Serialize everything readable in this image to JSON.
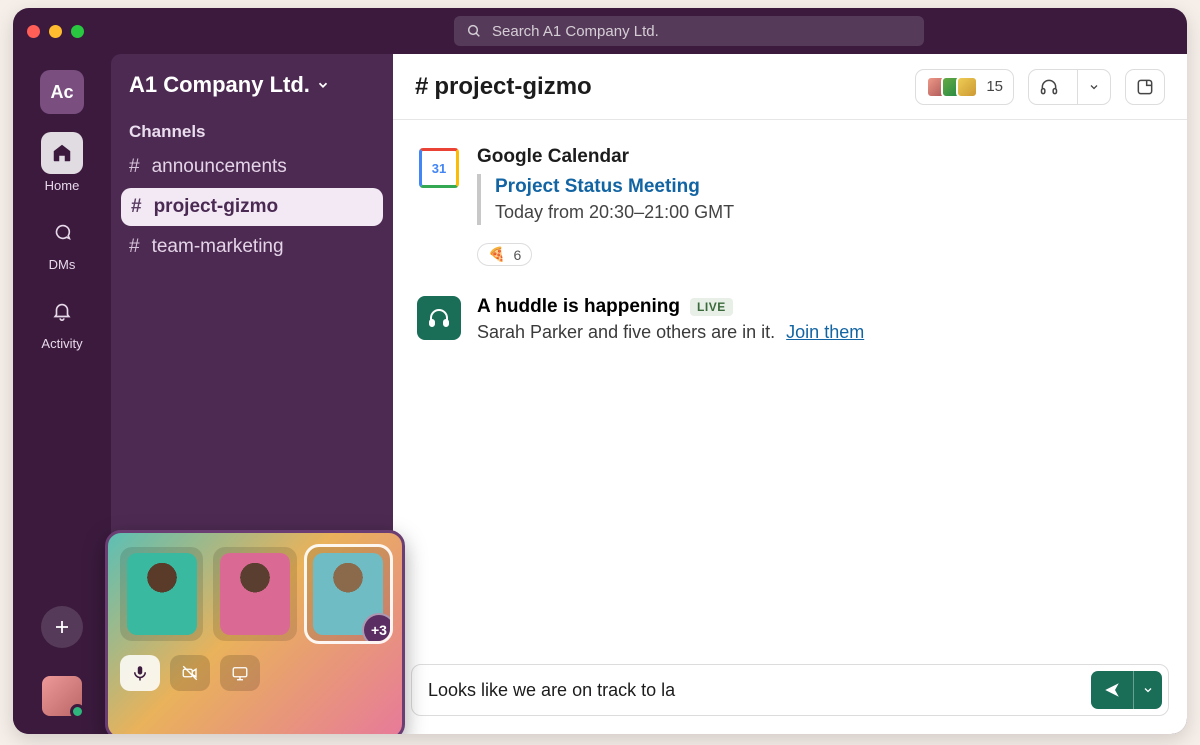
{
  "search": {
    "placeholder": "Search A1 Company Ltd."
  },
  "workspace": {
    "tile": "Ac",
    "name": "A1 Company Ltd."
  },
  "rail": {
    "items": [
      {
        "label": "Home"
      },
      {
        "label": "DMs"
      },
      {
        "label": "Activity"
      }
    ]
  },
  "sidebar": {
    "sectionLabel": "Channels",
    "channels": [
      {
        "name": "announcements"
      },
      {
        "name": "project-gizmo"
      },
      {
        "name": "team-marketing"
      }
    ]
  },
  "huddleWidget": {
    "moreCount": "+3"
  },
  "channelHeader": {
    "name": "project-gizmo",
    "memberCount": "15"
  },
  "messages": {
    "gcal": {
      "sender": "Google Calendar",
      "iconDay": "31",
      "eventTitle": "Project Status Meeting",
      "eventTime": "Today from 20:30–21:00 GMT",
      "reactionEmoji": "🍕",
      "reactionCount": "6"
    },
    "huddle": {
      "title": "A huddle is happening",
      "live": "LIVE",
      "detail": "Sarah Parker and five others are in it.",
      "joinLabel": "Join them"
    }
  },
  "composer": {
    "draft": "Looks like we are on track to la"
  }
}
